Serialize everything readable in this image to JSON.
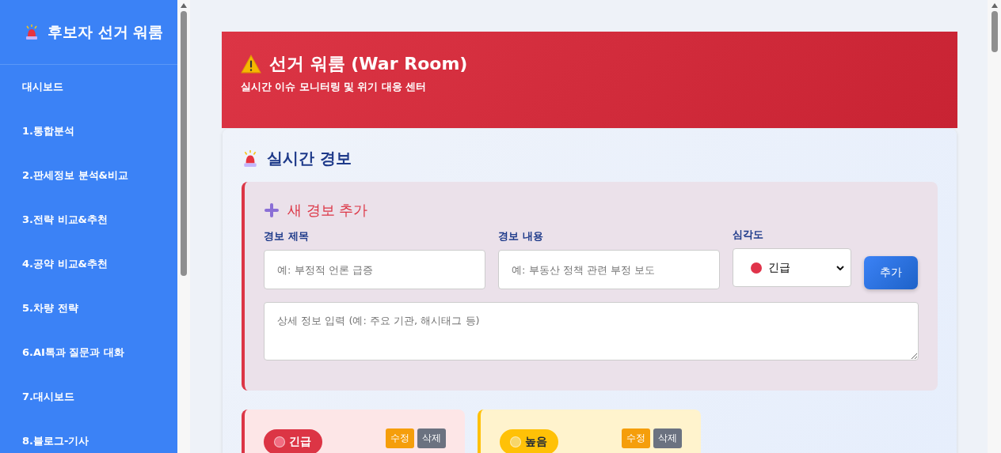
{
  "sidebar": {
    "title": "후보자 선거 워룸",
    "items": [
      {
        "label": "대시보드"
      },
      {
        "label": "1.통합분석"
      },
      {
        "label": "2.판세정보 분석&비교"
      },
      {
        "label": "3.전략 비교&추천"
      },
      {
        "label": "4.공약 비교&추천"
      },
      {
        "label": "5.차량 전략"
      },
      {
        "label": "6.AI톡과 질문과 대화"
      },
      {
        "label": "7.대시보드"
      },
      {
        "label": "8.블로그-기사"
      }
    ]
  },
  "header": {
    "title": "선거 워룸 (War Room)",
    "subtitle": "실시간 이슈 모니터링 및 위기 대응 센터"
  },
  "section": {
    "title": "실시간 경보",
    "form": {
      "title": "새 경보 추가",
      "fields": [
        {
          "label": "경보 제목",
          "placeholder": "예: 부정적 언론 급증"
        },
        {
          "label": "경보 내용",
          "placeholder": "예: 부동산 정책 관련 부정 보도"
        }
      ],
      "severity": {
        "label": "심각도",
        "value": "긴급",
        "color": "#e0334a"
      },
      "button": "추가",
      "details": {
        "placeholder": "상세 정보 입력 (예: 주요 기관, 해시태그 등)"
      }
    },
    "alerts": [
      {
        "kind": "urgent",
        "badge": "긴급",
        "color": "#f26d82",
        "actions": [
          "수정",
          "삭제"
        ]
      },
      {
        "kind": "high",
        "badge": "높음",
        "color": "#f7d66a",
        "actions": [
          "수정",
          "삭제"
        ]
      }
    ]
  }
}
